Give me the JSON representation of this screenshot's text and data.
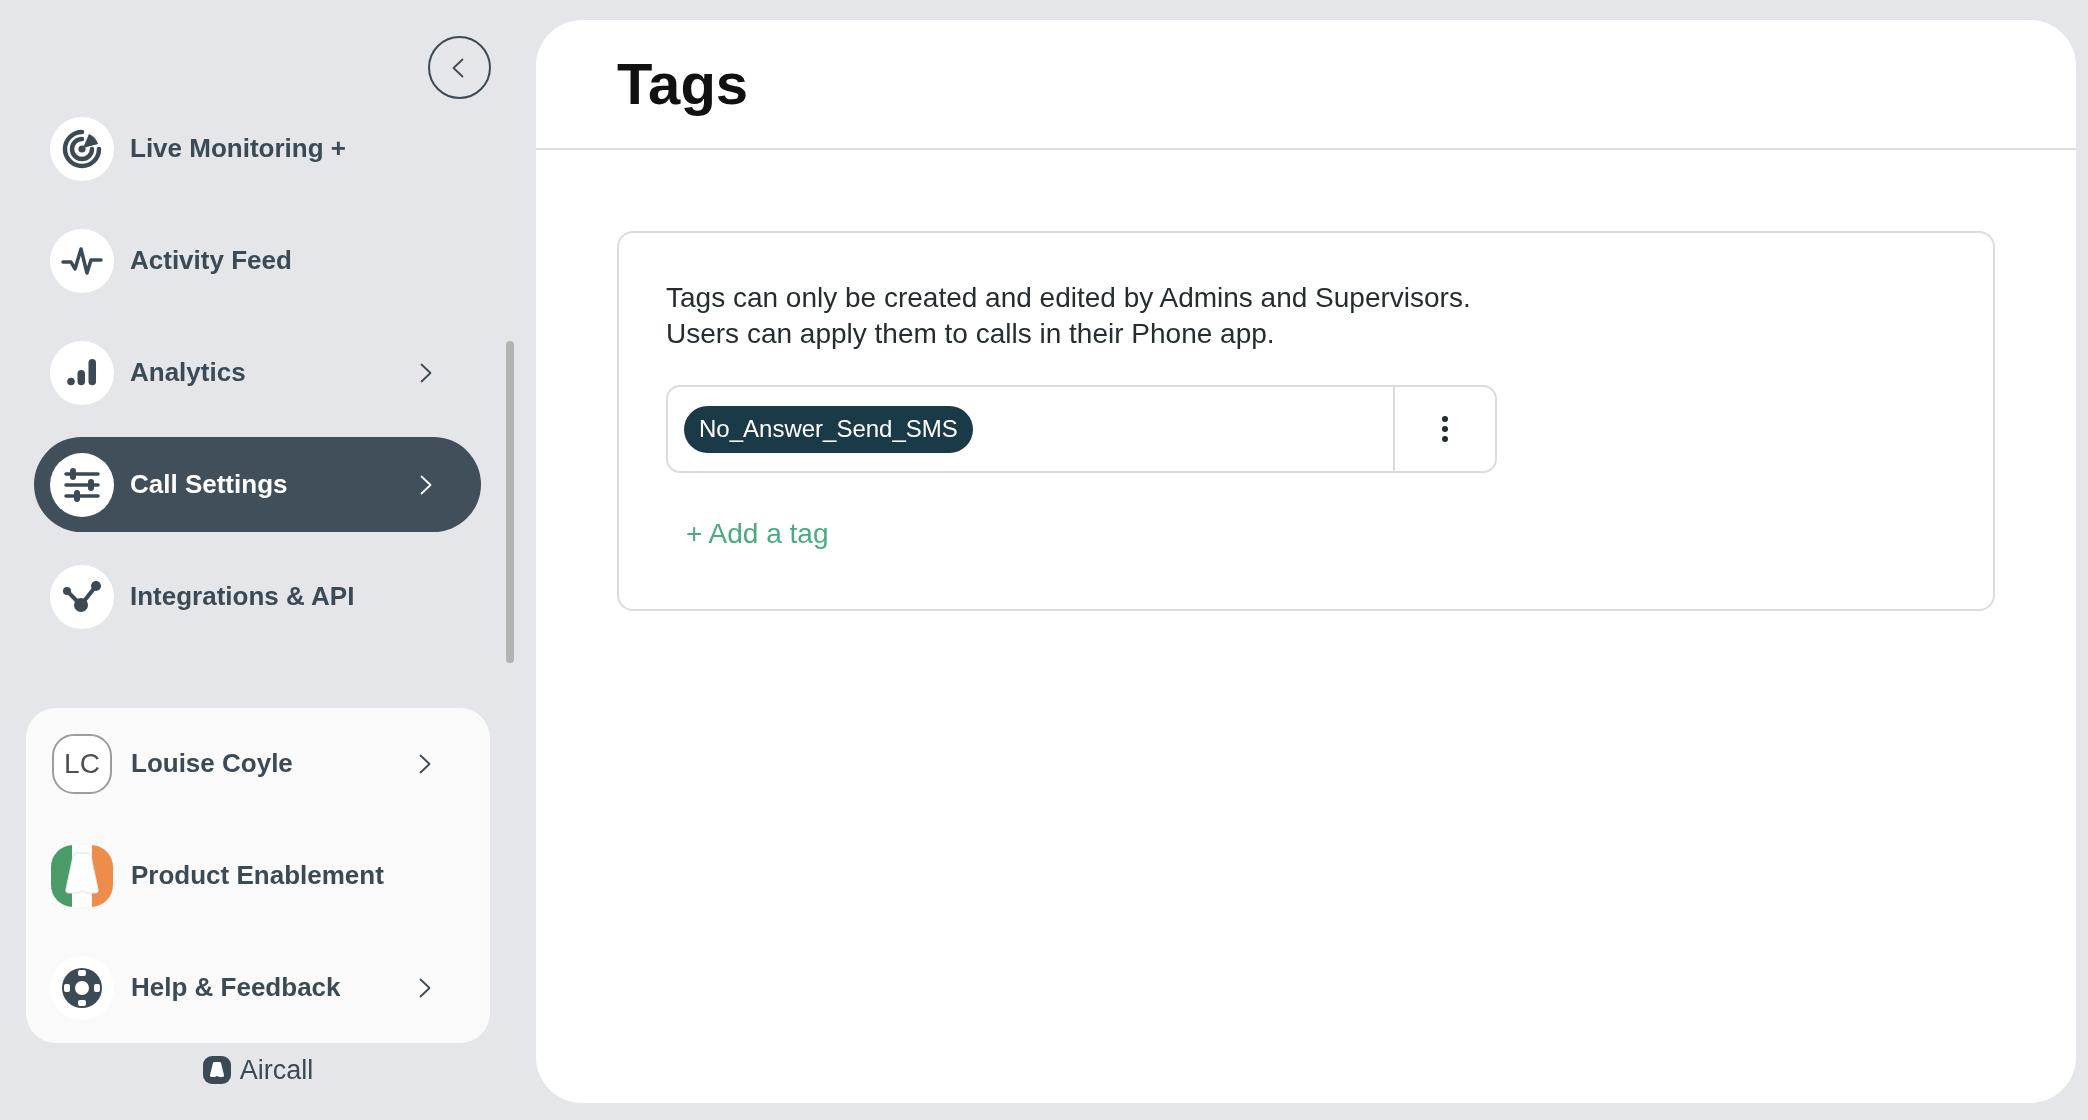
{
  "sidebar": {
    "nav_items": [
      {
        "label": "Live Monitoring +",
        "submenu": false,
        "selected": false
      },
      {
        "label": "Activity Feed",
        "submenu": false,
        "selected": false
      },
      {
        "label": "Analytics",
        "submenu": true,
        "selected": false
      },
      {
        "label": "Call Settings",
        "submenu": true,
        "selected": true
      },
      {
        "label": "Integrations & API",
        "submenu": false,
        "selected": false
      }
    ],
    "account_menu": [
      {
        "kind": "avatar",
        "label": "Louise Coyle",
        "initials": "LC",
        "submenu": true
      },
      {
        "kind": "icon",
        "label": "Product Enablement",
        "submenu": false
      },
      {
        "kind": "icon",
        "label": "Help & Feedback",
        "submenu": true
      }
    ],
    "brand": {
      "name": "Aircall"
    }
  },
  "main": {
    "title": "Tags",
    "description": "Tags can only be created and edited by Admins and Supervisors.\nUsers can apply them to calls in their Phone app.",
    "tags": [
      {
        "label": "No_Answer_Send_SMS",
        "color": "#1b3a48"
      }
    ],
    "add_button": {
      "label": "+ Add a tag"
    }
  }
}
